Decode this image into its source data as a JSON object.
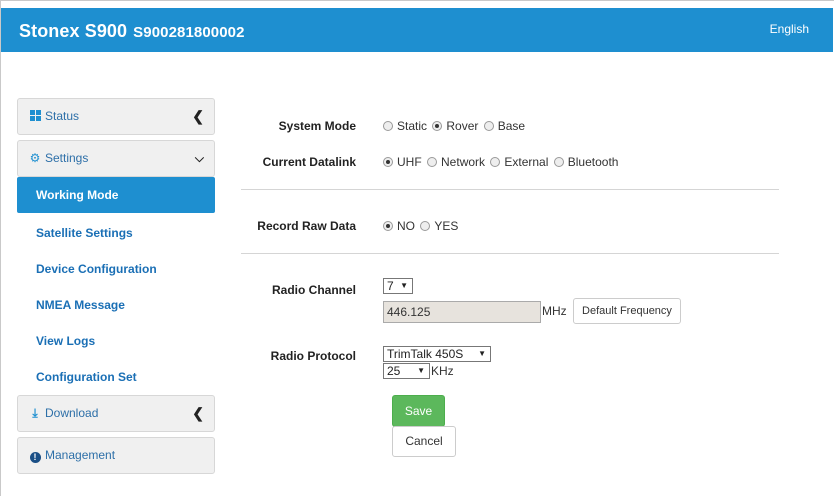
{
  "header": {
    "brand": "Stonex S900",
    "serial": "S900281800002",
    "language": "English"
  },
  "sidebar": {
    "status": {
      "label": "Status",
      "icon": "grid-icon"
    },
    "settings": {
      "label": "Settings",
      "icon": "gear-icon"
    },
    "settings_items": [
      {
        "label": "Working Mode",
        "active": true
      },
      {
        "label": "Satellite Settings"
      },
      {
        "label": "Device Configuration"
      },
      {
        "label": "NMEA Message"
      },
      {
        "label": "View Logs"
      },
      {
        "label": "Configuration Set"
      }
    ],
    "download": {
      "label": "Download",
      "icon": "download-icon"
    },
    "management": {
      "label": "Management",
      "icon": "info-circle-icon"
    }
  },
  "form": {
    "system_mode": {
      "label": "System Mode",
      "options": [
        "Static",
        "Rover",
        "Base"
      ],
      "selected": "Rover"
    },
    "current_datalink": {
      "label": "Current Datalink",
      "options": [
        "UHF",
        "Network",
        "External",
        "Bluetooth"
      ],
      "selected": "UHF"
    },
    "record_raw_data": {
      "label": "Record Raw Data",
      "options": [
        "NO",
        "YES"
      ],
      "selected": "NO"
    },
    "radio_channel": {
      "label": "Radio Channel",
      "channel": "7",
      "frequency": "446.125",
      "unit": "MHz",
      "default_button": "Default Frequency"
    },
    "radio_protocol": {
      "label": "Radio Protocol",
      "protocol": "TrimTalk 450S",
      "bandwidth": "25",
      "unit": "KHz"
    },
    "save_label": "Save",
    "cancel_label": "Cancel"
  },
  "colors": {
    "brand_blue": "#1e8fd0",
    "save_green": "#5cb85c"
  }
}
